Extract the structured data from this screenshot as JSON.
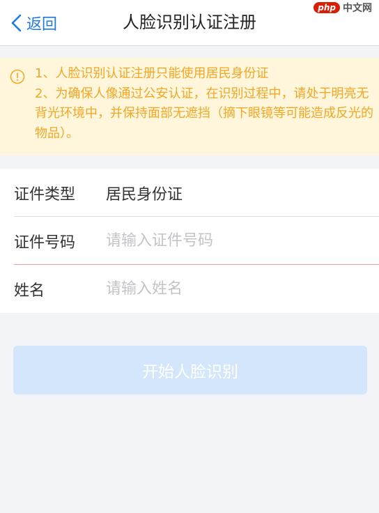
{
  "navbar": {
    "back_label": "返回",
    "title": "人脸识别认证注册"
  },
  "watermark": {
    "badge": "php",
    "text": "中文网"
  },
  "notice": {
    "line1": "1、人脸识别认证注册只能使用居民身份证",
    "line2": "2、为确保人像通过公安认证，在识别过程中，请处于明亮无背光环境中，并保持面部无遮挡（摘下眼镜等可能造成反光的物品）。",
    "color": "#f5a623",
    "background": "#fff6dc"
  },
  "form": {
    "id_type": {
      "label": "证件类型",
      "value": "居民身份证"
    },
    "id_number": {
      "label": "证件号码",
      "placeholder": "请输入证件号码",
      "value": ""
    },
    "name": {
      "label": "姓名",
      "placeholder": "请输入姓名",
      "value": ""
    }
  },
  "start_button": {
    "label": "开始人脸识别",
    "background": "#d3e6fb"
  },
  "accent_color": "#1f7ae0"
}
